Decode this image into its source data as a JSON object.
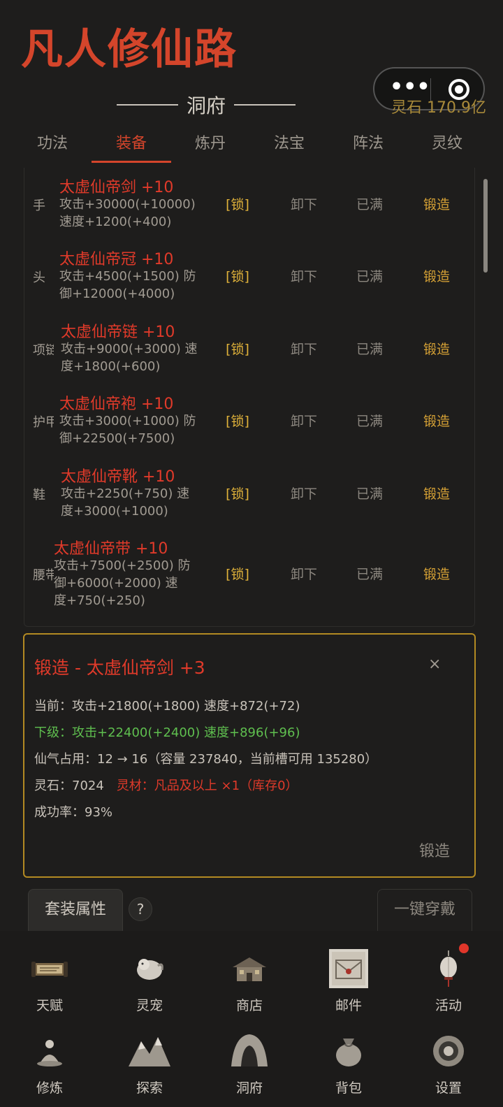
{
  "app_title": "凡人修仙路",
  "spirit_stone": "灵石 170.9亿",
  "section_title": "洞府",
  "tabs": [
    {
      "label": "功法"
    },
    {
      "label": "装备"
    },
    {
      "label": "炼丹"
    },
    {
      "label": "法宝"
    },
    {
      "label": "阵法"
    },
    {
      "label": "灵纹"
    }
  ],
  "active_tab": "装备",
  "equipment": [
    {
      "slot": "手",
      "name": "太虚仙帝剑 +10",
      "stats": [
        "攻击+30000(+10000)",
        "速度+1200(+400)"
      ],
      "lock": "[锁]",
      "unequip": "卸下",
      "status": "已满",
      "forge": "锻造"
    },
    {
      "slot": "头",
      "name": "太虚仙帝冠 +10",
      "stats": [
        "攻击+4500(+1500) 防",
        "御+12000(+4000)"
      ],
      "lock": "[锁]",
      "unequip": "卸下",
      "status": "已满",
      "forge": "锻造"
    },
    {
      "slot": "项链",
      "name": "太虚仙帝链 +10",
      "stats": [
        "攻击+9000(+3000) 速",
        "度+1800(+600)"
      ],
      "lock": "[锁]",
      "unequip": "卸下",
      "status": "已满",
      "forge": "锻造"
    },
    {
      "slot": "护甲",
      "name": "太虚仙帝袍 +10",
      "stats": [
        "攻击+3000(+1000) 防",
        "御+22500(+7500)"
      ],
      "lock": "[锁]",
      "unequip": "卸下",
      "status": "已满",
      "forge": "锻造"
    },
    {
      "slot": "鞋",
      "name": "太虚仙帝靴 +10",
      "stats": [
        "攻击+2250(+750) 速",
        "度+3000(+1000)"
      ],
      "lock": "[锁]",
      "unequip": "卸下",
      "status": "已满",
      "forge": "锻造"
    },
    {
      "slot": "腰带",
      "name": "太虚仙帝带 +10",
      "stats": [
        "攻击+7500(+2500) 防",
        "御+6000(+2000) 速",
        "度+750(+250)"
      ],
      "lock": "[锁]",
      "unequip": "卸下",
      "status": "已满",
      "forge": "锻造"
    }
  ],
  "forge_panel": {
    "title": "锻造 - 太虚仙帝剑 +3",
    "close": "×",
    "current": "当前：攻击+21800(+1800) 速度+872(+72)",
    "next": "下级：攻击+22400(+2400) 速度+896(+96)",
    "qi_usage": "仙气占用：12 → 16（容量 237840，当前槽可用 135280）",
    "stone_cost": "灵石：7024",
    "material": "灵材：凡品及以上 ×1（库存0）",
    "success_rate": "成功率：93%",
    "forge_button": "锻造"
  },
  "set_attributes_button": "套装属性",
  "help_button": "?",
  "equip_all_button": "一键穿戴",
  "nav": [
    {
      "label": "天赋",
      "icon": "scroll-icon"
    },
    {
      "label": "灵宠",
      "icon": "pet-icon"
    },
    {
      "label": "商店",
      "icon": "shop-icon"
    },
    {
      "label": "邮件",
      "icon": "mail-icon"
    },
    {
      "label": "活动",
      "icon": "lantern-icon",
      "badge": true
    },
    {
      "label": "修炼",
      "icon": "cultivate-icon"
    },
    {
      "label": "探索",
      "icon": "mountain-icon"
    },
    {
      "label": "洞府",
      "icon": "cave-icon"
    },
    {
      "label": "背包",
      "icon": "bag-icon"
    },
    {
      "label": "设置",
      "icon": "settings-icon"
    }
  ],
  "colors": {
    "accent_red": "#d4452b",
    "gold": "#d4a035",
    "green": "#5fbf4f"
  }
}
